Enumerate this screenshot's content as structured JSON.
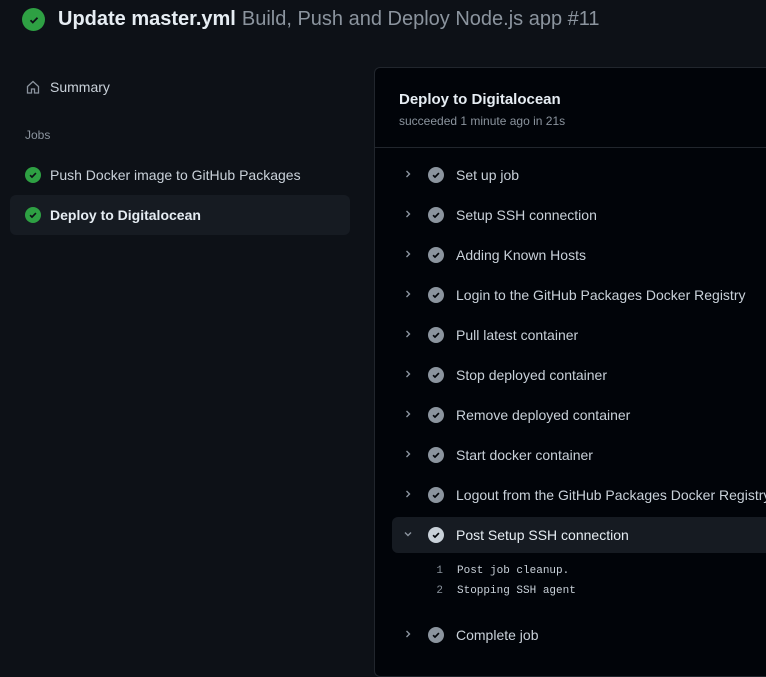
{
  "header": {
    "commit": "Update master.yml",
    "workflow": "Build, Push and Deploy Node.js app #11",
    "status": "success"
  },
  "sidebar": {
    "summary": "Summary",
    "jobs_heading": "Jobs",
    "jobs": [
      {
        "label": "Push Docker image to GitHub Packages",
        "status": "success"
      },
      {
        "label": "Deploy to Digitalocean",
        "status": "success",
        "active": true
      }
    ]
  },
  "job": {
    "title": "Deploy to Digitalocean",
    "subtitle": "succeeded 1 minute ago in 21s",
    "steps": [
      "Set up job",
      "Setup SSH connection",
      "Adding Known Hosts",
      "Login to the GitHub Packages Docker Registry",
      "Pull latest container",
      "Stop deployed container",
      "Remove deployed container",
      "Start docker container",
      "Logout from the GitHub Packages Docker Registry",
      "Post Setup SSH connection",
      "Complete job"
    ],
    "expanded_step": 9,
    "log": [
      {
        "n": "1",
        "text": "Post job cleanup."
      },
      {
        "n": "2",
        "text": "Stopping SSH agent"
      }
    ]
  },
  "colors": {
    "success": "#2ea043",
    "background": "#0d1117"
  }
}
